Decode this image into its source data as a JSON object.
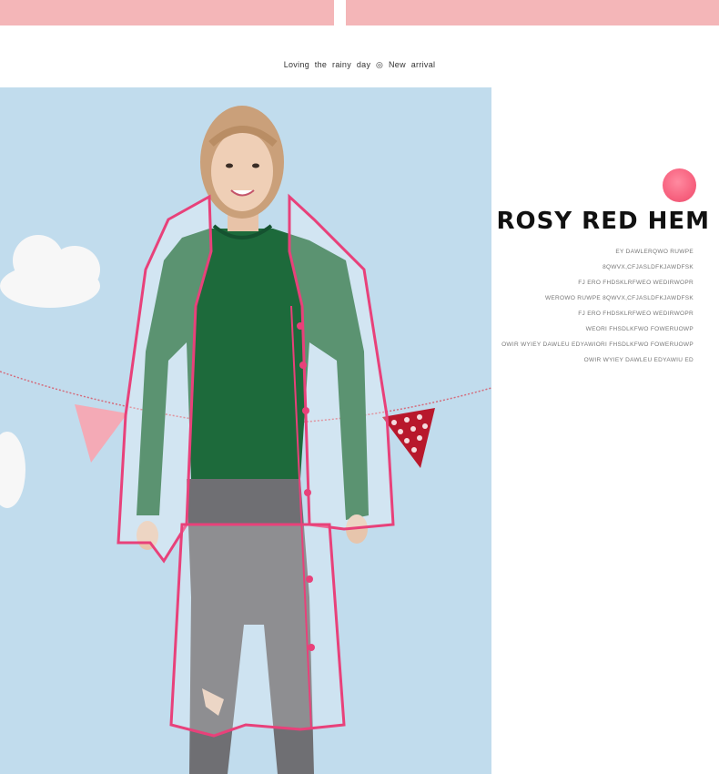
{
  "tagline": "Loving the rainy day ◎ New arrival",
  "headline": "ROSY RED HEM",
  "description": [
    "EY DAWLERQWO RUWPE",
    "8QWVX,CFJASLDFKJAWDFSK",
    "FJ ERO FHDSKLRFWEO WEDIRWOPR",
    "WEROWO RUWPE 8QWVX,CFJASLDFKJAWDFSK",
    "FJ ERO FHDSKLRFWEO WEDIRWOPR",
    "WEORI FHSDLKFWO FOWERUOWP",
    "OWIR WYIEY DAWLEU EDYAWIORI FHSDLKFWO FOWERUOWP",
    "OWIR WYIEY DAWLEU EDYAWIU ED"
  ],
  "colors": {
    "accent_pink": "#f7627f",
    "raincoat_trim": "#e8417a",
    "sweater_green": "#1d6a3b",
    "background_blue": "#c1dced"
  },
  "icons": {
    "dot": "pink-dot-icon"
  }
}
